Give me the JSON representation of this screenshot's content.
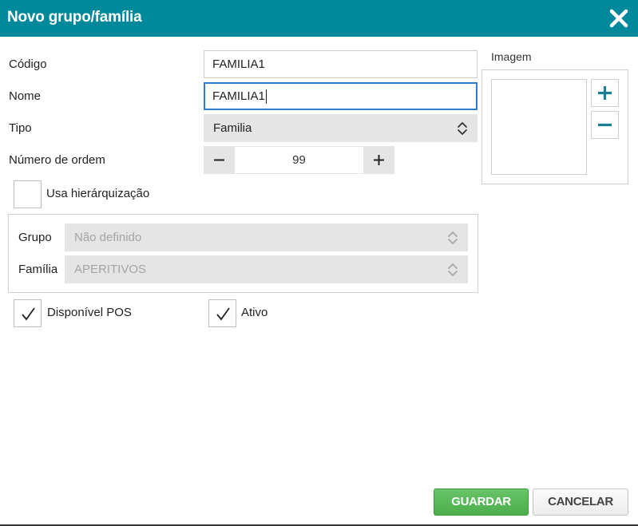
{
  "dialog": {
    "title": "Novo grupo/família"
  },
  "form": {
    "codigo": {
      "label": "Código",
      "value": "FAMILIA1"
    },
    "nome": {
      "label": "Nome",
      "value": "FAMILIA1"
    },
    "tipo": {
      "label": "Tipo",
      "value": "Familia"
    },
    "numero_ordem": {
      "label": "Número de ordem",
      "value": "99"
    },
    "hierarquizacao": {
      "label": "Usa hierárquização",
      "checked": false
    },
    "grupo": {
      "label": "Grupo",
      "value": "Não definido"
    },
    "familia": {
      "label": "Família",
      "value": "APERITIVOS"
    },
    "disponivel_pos": {
      "label": "Disponível POS",
      "checked": true
    },
    "ativo": {
      "label": "Ativo",
      "checked": true
    }
  },
  "image": {
    "label": "Imagem"
  },
  "buttons": {
    "save": "GUARDAR",
    "cancel": "CANCELAR"
  },
  "colors": {
    "header": "#00899a",
    "save": "#5cb85c",
    "focus": "#2c7cd1",
    "image_buttons": "#1b7f95"
  },
  "icons": {
    "close": "close-icon",
    "add_image": "plus-icon",
    "remove_image": "minus-icon",
    "select": "chevron-up-down-icon",
    "checked": "checkmark-icon"
  }
}
